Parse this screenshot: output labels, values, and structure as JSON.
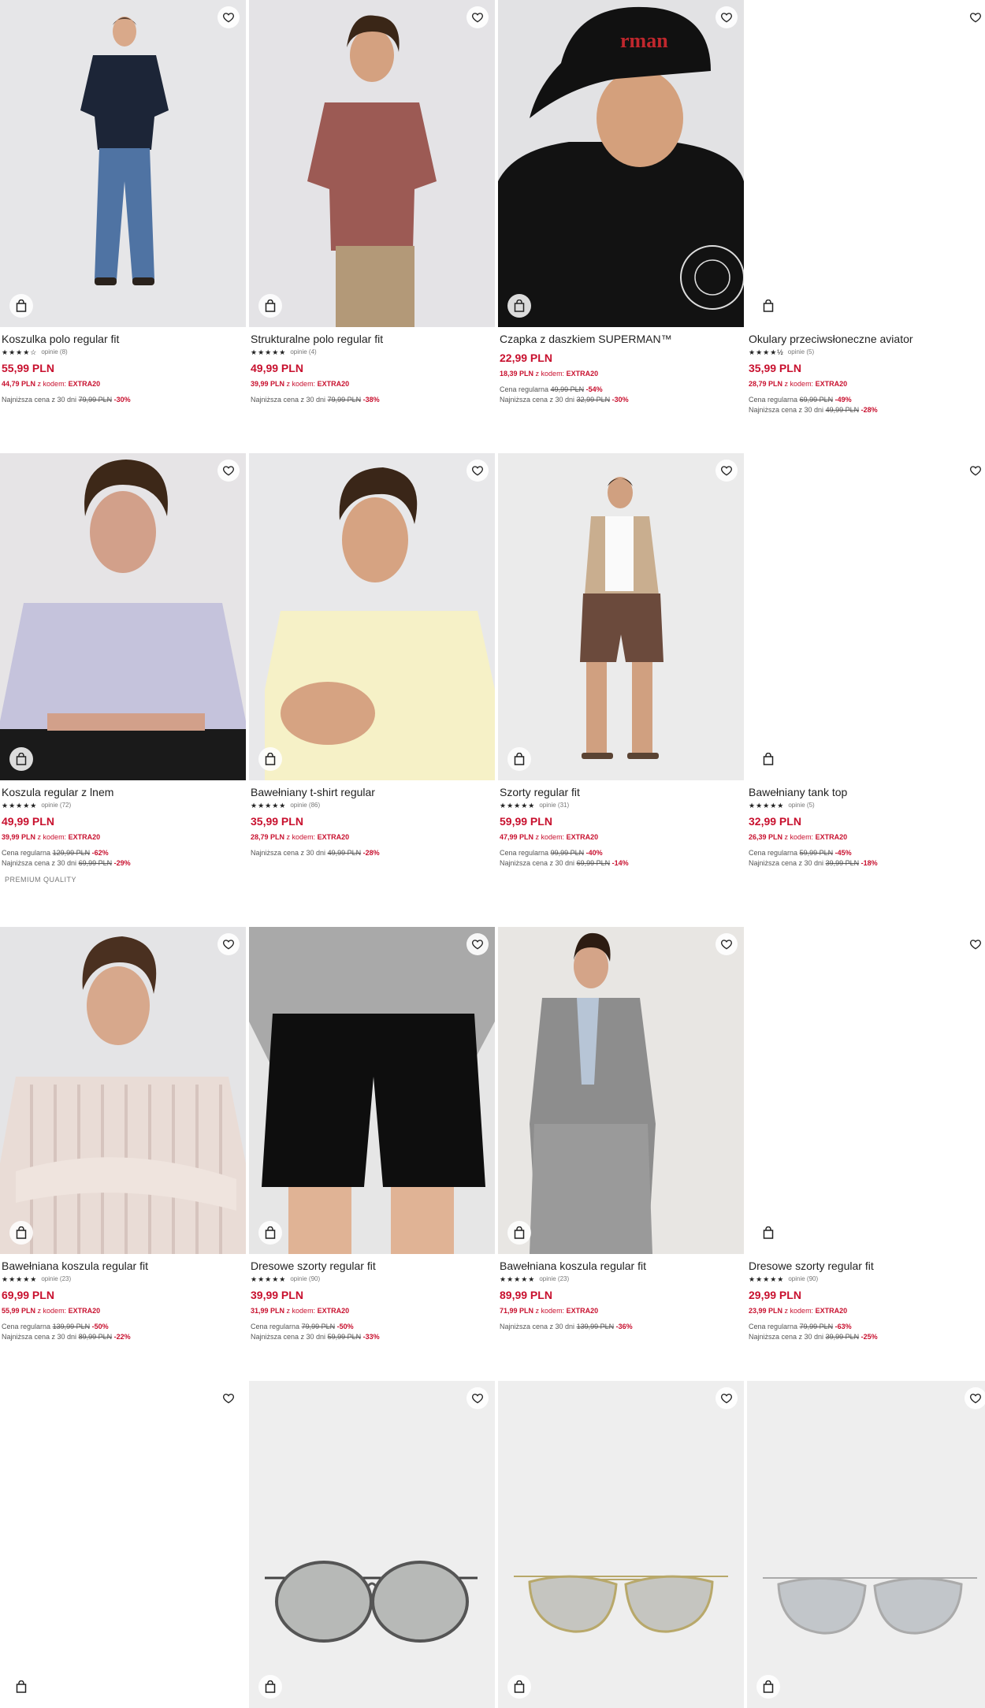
{
  "products": [
    {
      "name": "Koszulka polo regular fit",
      "stars": "★★★★☆",
      "reviews": "opinie (8)",
      "price": "55,99 PLN",
      "code_price": "44,79 PLN",
      "code_label": "z kodem:",
      "code": "EXTRA20",
      "regular_label": "",
      "regular_old": "",
      "regular_pct": "",
      "lowest_label": "Najniższa cena z 30 dni",
      "lowest_old": "79,99 PLN",
      "lowest_pct": "-30%",
      "badge": "",
      "photo": "man-navy-polo"
    },
    {
      "name": "Strukturalne polo regular fit",
      "stars": "★★★★★",
      "reviews": "opinie (4)",
      "price": "49,99 PLN",
      "code_price": "39,99 PLN",
      "code_label": "z kodem:",
      "code": "EXTRA20",
      "regular_label": "",
      "regular_old": "",
      "regular_pct": "",
      "lowest_label": "Najniższa cena z 30 dni",
      "lowest_old": "79,99 PLN",
      "lowest_pct": "-38%",
      "badge": "",
      "photo": "man-red-polo"
    },
    {
      "name": "Czapka z daszkiem SUPERMAN™",
      "stars": "",
      "reviews": "",
      "price": "22,99 PLN",
      "code_price": "18,39 PLN",
      "code_label": "z kodem:",
      "code": "EXTRA20",
      "regular_label": "Cena regularna",
      "regular_old": "49,99 PLN",
      "regular_pct": "-54%",
      "lowest_label": "Najniższa cena z 30 dni",
      "lowest_old": "32,99 PLN",
      "lowest_pct": "-30%",
      "badge": "",
      "photo": "cap"
    },
    {
      "name": "Okulary przeciwsłoneczne aviator",
      "stars": "★★★★½",
      "reviews": "opinie (5)",
      "price": "35,99 PLN",
      "code_price": "28,79 PLN",
      "code_label": "z kodem:",
      "code": "EXTRA20",
      "regular_label": "Cena regularna",
      "regular_old": "69,99 PLN",
      "regular_pct": "-49%",
      "lowest_label": "Najniższa cena z 30 dni",
      "lowest_old": "49,99 PLN",
      "lowest_pct": "-28%",
      "badge": "",
      "photo": "blank"
    },
    {
      "name": "Koszula regular z lnem",
      "stars": "★★★★★",
      "reviews": "opinie (72)",
      "price": "49,99 PLN",
      "code_price": "39,99 PLN",
      "code_label": "z kodem:",
      "code": "EXTRA20",
      "regular_label": "Cena regularna",
      "regular_old": "129,99 PLN",
      "regular_pct": "-62%",
      "lowest_label": "Najniższa cena z 30 dni",
      "lowest_old": "69,99 PLN",
      "lowest_pct": "-29%",
      "badge": "PREMIUM QUALITY",
      "photo": "man-linen-shirt"
    },
    {
      "name": "Bawełniany t-shirt regular",
      "stars": "★★★★★",
      "reviews": "opinie (86)",
      "price": "35,99 PLN",
      "code_price": "28,79 PLN",
      "code_label": "z kodem:",
      "code": "EXTRA20",
      "regular_label": "",
      "regular_old": "",
      "regular_pct": "",
      "lowest_label": "Najniższa cena z 30 dni",
      "lowest_old": "49,99 PLN",
      "lowest_pct": "-28%",
      "badge": "",
      "photo": "man-yellow-tee"
    },
    {
      "name": "Szorty regular fit",
      "stars": "★★★★★",
      "reviews": "opinie (31)",
      "price": "59,99 PLN",
      "code_price": "47,99 PLN",
      "code_label": "z kodem:",
      "code": "EXTRA20",
      "regular_label": "Cena regularna",
      "regular_old": "99,99 PLN",
      "regular_pct": "-40%",
      "lowest_label": "Najniższa cena z 30 dni",
      "lowest_old": "69,99 PLN",
      "lowest_pct": "-14%",
      "badge": "",
      "photo": "man-shorts"
    },
    {
      "name": "Bawełniany tank top",
      "stars": "★★★★★",
      "reviews": "opinie (5)",
      "price": "32,99 PLN",
      "code_price": "26,39 PLN",
      "code_label": "z kodem:",
      "code": "EXTRA20",
      "regular_label": "Cena regularna",
      "regular_old": "59,99 PLN",
      "regular_pct": "-45%",
      "lowest_label": "Najniższa cena z 30 dni",
      "lowest_old": "39,99 PLN",
      "lowest_pct": "-18%",
      "badge": "",
      "photo": "blank"
    },
    {
      "name": "Bawełniana koszula regular fit",
      "stars": "★★★★★",
      "reviews": "opinie (23)",
      "price": "69,99 PLN",
      "code_price": "55,99 PLN",
      "code_label": "z kodem:",
      "code": "EXTRA20",
      "regular_label": "Cena regularna",
      "regular_old": "139,99 PLN",
      "regular_pct": "-50%",
      "lowest_label": "Najniższa cena z 30 dni",
      "lowest_old": "89,99 PLN",
      "lowest_pct": "-22%",
      "badge": "",
      "photo": "man-striped-shirt"
    },
    {
      "name": "Dresowe szorty regular fit",
      "stars": "★★★★★",
      "reviews": "opinie (90)",
      "price": "39,99 PLN",
      "code_price": "31,99 PLN",
      "code_label": "z kodem:",
      "code": "EXTRA20",
      "regular_label": "Cena regularna",
      "regular_old": "79,99 PLN",
      "regular_pct": "-50%",
      "lowest_label": "Najniższa cena z 30 dni",
      "lowest_old": "59,99 PLN",
      "lowest_pct": "-33%",
      "badge": "",
      "photo": "black-shorts"
    },
    {
      "name": "Bawełniana koszula regular fit",
      "stars": "★★★★★",
      "reviews": "opinie (23)",
      "price": "89,99 PLN",
      "code_price": "71,99 PLN",
      "code_label": "z kodem:",
      "code": "EXTRA20",
      "regular_label": "",
      "regular_old": "",
      "regular_pct": "",
      "lowest_label": "Najniższa cena z 30 dni",
      "lowest_old": "139,99 PLN",
      "lowest_pct": "-36%",
      "badge": "",
      "photo": "man-grey-suit"
    },
    {
      "name": "Dresowe szorty regular fit",
      "stars": "★★★★★",
      "reviews": "opinie (90)",
      "price": "29,99 PLN",
      "code_price": "23,99 PLN",
      "code_label": "z kodem:",
      "code": "EXTRA20",
      "regular_label": "Cena regularna",
      "regular_old": "79,99 PLN",
      "regular_pct": "-63%",
      "lowest_label": "Najniższa cena z 30 dni",
      "lowest_old": "39,99 PLN",
      "lowest_pct": "-25%",
      "badge": "",
      "photo": "blank"
    },
    {
      "name": "",
      "stars": "",
      "reviews": "",
      "price": "",
      "code_price": "",
      "code_label": "",
      "code": "",
      "regular_label": "",
      "regular_old": "",
      "regular_pct": "",
      "lowest_label": "",
      "lowest_old": "",
      "lowest_pct": "",
      "badge": "",
      "photo": "blank"
    },
    {
      "name": "",
      "stars": "",
      "reviews": "",
      "price": "",
      "code_price": "",
      "code_label": "",
      "code": "",
      "regular_label": "",
      "regular_old": "",
      "regular_pct": "",
      "lowest_label": "",
      "lowest_old": "",
      "lowest_pct": "",
      "badge": "",
      "photo": "sunglasses-round"
    },
    {
      "name": "",
      "stars": "",
      "reviews": "",
      "price": "",
      "code_price": "",
      "code_label": "",
      "code": "",
      "regular_label": "",
      "regular_old": "",
      "regular_pct": "",
      "lowest_label": "",
      "lowest_old": "",
      "lowest_pct": "",
      "badge": "",
      "photo": "sunglasses-aviator-gold"
    },
    {
      "name": "",
      "stars": "",
      "reviews": "",
      "price": "",
      "code_price": "",
      "code_label": "",
      "code": "",
      "regular_label": "",
      "regular_old": "",
      "regular_pct": "",
      "lowest_label": "",
      "lowest_old": "",
      "lowest_pct": "",
      "badge": "",
      "photo": "sunglasses-aviator-silver"
    }
  ],
  "icons": {
    "favorite": "heart-icon",
    "cart": "shopping-bag-icon"
  },
  "colors": {
    "accent": "#c8102e",
    "text": "#222222",
    "muted": "#777777"
  }
}
